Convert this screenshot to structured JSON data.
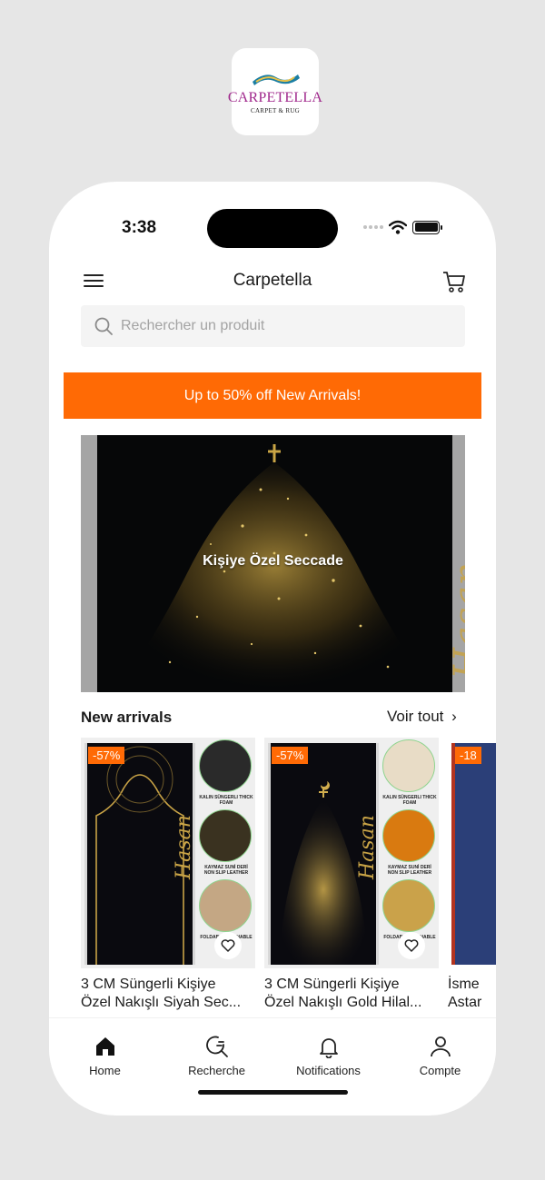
{
  "logo": {
    "brand": "CARPETELLA",
    "tagline": "CARPET & RUG"
  },
  "status_bar": {
    "time": "3:38"
  },
  "header": {
    "title": "Carpetella"
  },
  "search": {
    "placeholder": "Rechercher un produit"
  },
  "promo": {
    "text": "Up to 50% off New Arrivals!",
    "color": "#ff6a05"
  },
  "hero": {
    "title": "Kişiye Özel Seccade",
    "script_name": "Hasan"
  },
  "new_arrivals": {
    "title": "New arrivals",
    "see_all_label": "Voir tout",
    "products": [
      {
        "discount": "-57%",
        "name_line1": "3 CM Süngerli Kişiye",
        "name_line2": "Özel Nakışlı Siyah Sec...",
        "rug_name": "Hasan",
        "captions": [
          "KALIN SÜNGERLI THICK FOAM",
          "KAYMAZ SUNİ DERİ NON SLIP LEATHER",
          "FOLDABLE WASHABLE"
        ]
      },
      {
        "discount": "-57%",
        "name_line1": "3 CM Süngerli Kişiye",
        "name_line2": "Özel Nakışlı Gold Hilal...",
        "rug_name": "Hasan",
        "captions": [
          "KALIN SÜNGERLI THICK FOAM",
          "KAYMAZ SUNİ DERİ NON SLIP LEATHER",
          "FOLDABLE WASHABLE"
        ]
      },
      {
        "discount": "-18",
        "name_line1": "İsme",
        "name_line2": "Astar"
      }
    ]
  },
  "tabbar": {
    "items": [
      {
        "label": "Home",
        "icon": "home-icon"
      },
      {
        "label": "Recherche",
        "icon": "search-icon"
      },
      {
        "label": "Notifications",
        "icon": "bell-icon"
      },
      {
        "label": "Compte",
        "icon": "user-icon"
      }
    ]
  },
  "colors": {
    "accent": "#ff6a05",
    "brand_purple": "#a0288c",
    "gold": "#c8a346"
  }
}
